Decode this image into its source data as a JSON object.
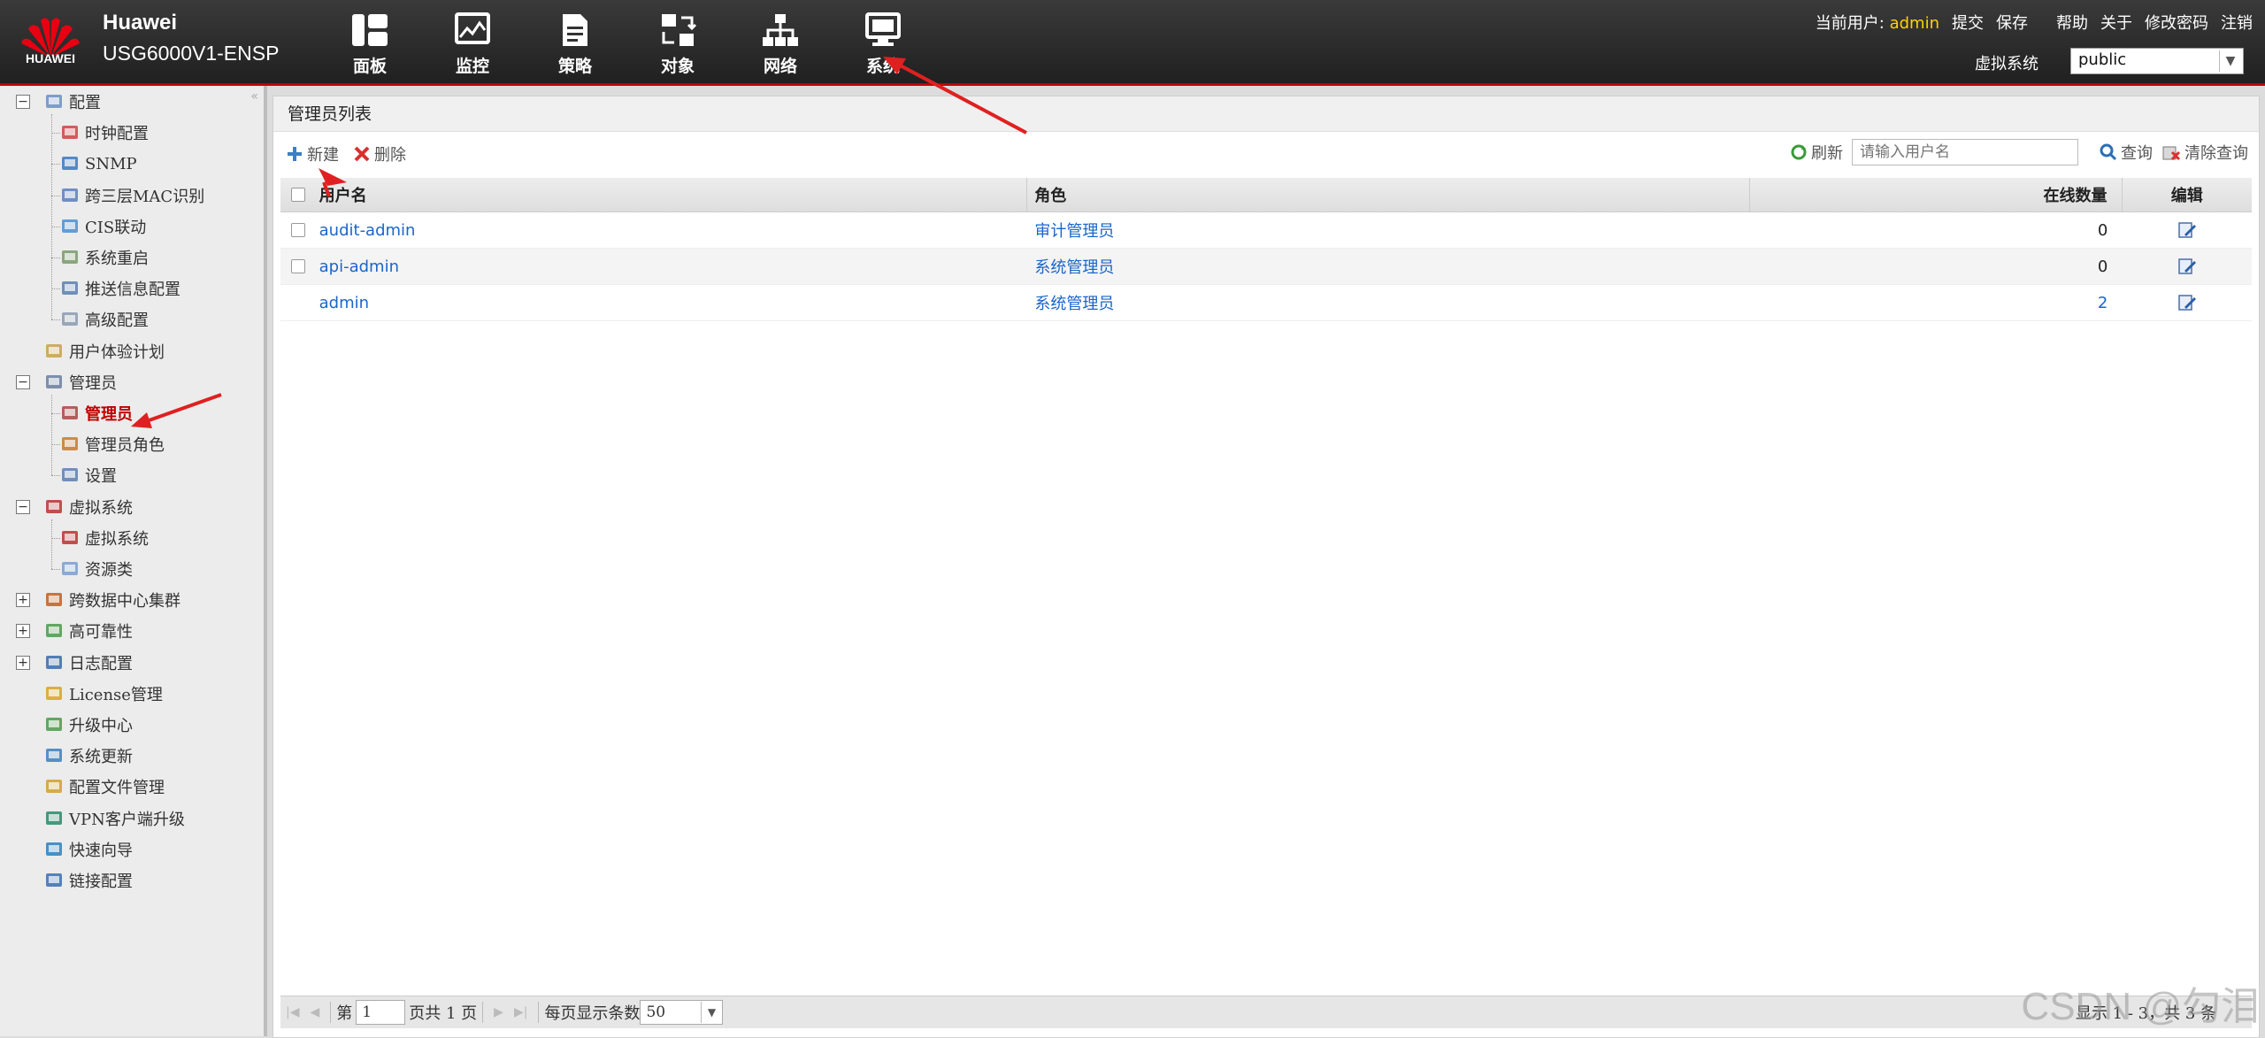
{
  "header": {
    "logo_text": "HUAWEI",
    "brand_line1": "Huawei",
    "brand_line2": "USG6000V1-ENSP",
    "nav": [
      {
        "label": "面板",
        "icon": "dashboard-icon"
      },
      {
        "label": "监控",
        "icon": "monitor-icon"
      },
      {
        "label": "策略",
        "icon": "policy-icon"
      },
      {
        "label": "对象",
        "icon": "object-icon"
      },
      {
        "label": "网络",
        "icon": "network-icon"
      },
      {
        "label": "系统",
        "icon": "system-icon"
      }
    ],
    "current_user_label": "当前用户:",
    "current_user": "admin",
    "links": [
      "提交",
      "保存",
      "帮助",
      "关于",
      "修改密码",
      "注销"
    ],
    "vsys_label": "虚拟系统",
    "vsys_value": "public"
  },
  "sidebar": {
    "items": [
      {
        "label": "配置",
        "level": 0,
        "icon": "config-icon"
      },
      {
        "label": "时钟配置",
        "level": 1,
        "icon": "clock-icon"
      },
      {
        "label": "SNMP",
        "level": 1,
        "icon": "snmp-icon"
      },
      {
        "label": "跨三层MAC识别",
        "level": 1,
        "icon": "mac-icon"
      },
      {
        "label": "CIS联动",
        "level": 1,
        "icon": "cis-icon"
      },
      {
        "label": "系统重启",
        "level": 1,
        "icon": "restart-icon"
      },
      {
        "label": "推送信息配置",
        "level": 1,
        "icon": "push-icon"
      },
      {
        "label": "高级配置",
        "level": 1,
        "icon": "advanced-icon"
      },
      {
        "label": "用户体验计划",
        "level": 0,
        "icon": "experience-icon"
      },
      {
        "label": "管理员",
        "level": 0,
        "icon": "admin-icon"
      },
      {
        "label": "管理员",
        "level": 1,
        "icon": "admin-icon"
      },
      {
        "label": "管理员角色",
        "level": 1,
        "icon": "role-icon"
      },
      {
        "label": "设置",
        "level": 1,
        "icon": "settings-icon"
      },
      {
        "label": "虚拟系统",
        "level": 0,
        "icon": "vsys-icon"
      },
      {
        "label": "虚拟系统",
        "level": 1,
        "icon": "vsys-icon"
      },
      {
        "label": "资源类",
        "level": 1,
        "icon": "resource-icon"
      },
      {
        "label": "跨数据中心集群",
        "level": 0,
        "icon": "cluster-icon"
      },
      {
        "label": "高可靠性",
        "level": 0,
        "icon": "ha-icon"
      },
      {
        "label": "日志配置",
        "level": 0,
        "icon": "log-icon"
      },
      {
        "label": "License管理",
        "level": 0,
        "icon": "license-icon"
      },
      {
        "label": "升级中心",
        "level": 0,
        "icon": "upgrade-icon"
      },
      {
        "label": "系统更新",
        "level": 0,
        "icon": "update-icon"
      },
      {
        "label": "配置文件管理",
        "level": 0,
        "icon": "file-icon"
      },
      {
        "label": "VPN客户端升级",
        "level": 0,
        "icon": "vpn-icon"
      },
      {
        "label": "快速向导",
        "level": 0,
        "icon": "wizard-icon"
      },
      {
        "label": "链接配置",
        "level": 0,
        "icon": "link-icon"
      }
    ]
  },
  "main": {
    "title": "管理员列表",
    "toolbar": {
      "new": "新建",
      "delete": "删除"
    },
    "search": {
      "refresh": "刷新",
      "placeholder": "请输入用户名",
      "query": "查询",
      "clear": "清除查询"
    },
    "columns": [
      "用户名",
      "角色",
      "在线数量",
      "编辑"
    ],
    "rows": [
      {
        "username": "audit-admin",
        "role": "审计管理员",
        "online": "0"
      },
      {
        "username": "api-admin",
        "role": "系统管理员",
        "online": "0"
      },
      {
        "username": "admin",
        "role": "系统管理员",
        "online": "2"
      }
    ],
    "pager": {
      "page_prefix": "第",
      "page": "1",
      "page_suffix": "页共 1 页",
      "per_page_label": "每页显示条数",
      "per_page": "50",
      "info": "显示 1 - 3，共 3 条"
    }
  },
  "watermark": "CSDN @勾泪",
  "colors": {
    "accent_red": "#c00000",
    "link": "#1a66c9",
    "user_yellow": "#ffd200"
  }
}
